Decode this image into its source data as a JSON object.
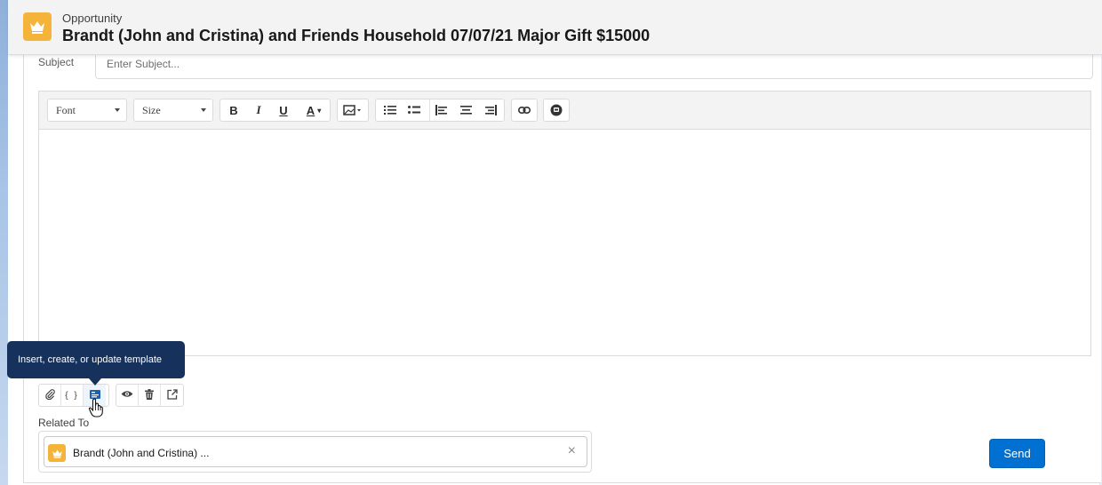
{
  "header": {
    "object_type": "Opportunity",
    "title": "Brandt (John and Cristina) and Friends Household 07/07/21 Major Gift $15000",
    "icon": "crown-icon",
    "icon_color": "#f4b43a"
  },
  "email": {
    "subject_label": "Subject",
    "subject_placeholder": "Enter Subject...",
    "subject_value": ""
  },
  "toolbar": {
    "font_select": "Font",
    "size_select": "Size",
    "bold": "B",
    "italic": "I",
    "underline": "U",
    "text_color": "A"
  },
  "tooltip": {
    "text": "Insert, create, or update template"
  },
  "related": {
    "label": "Related To",
    "value": "Brandt (John and Cristina) ...",
    "icon": "crown-icon",
    "clear_glyph": "×"
  },
  "actions": {
    "send_label": "Send",
    "merge_field_glyph": "{ }"
  },
  "colors": {
    "brand_blue": "#0070d2",
    "tooltip_bg": "#16325c",
    "crown": "#f4b43a"
  }
}
